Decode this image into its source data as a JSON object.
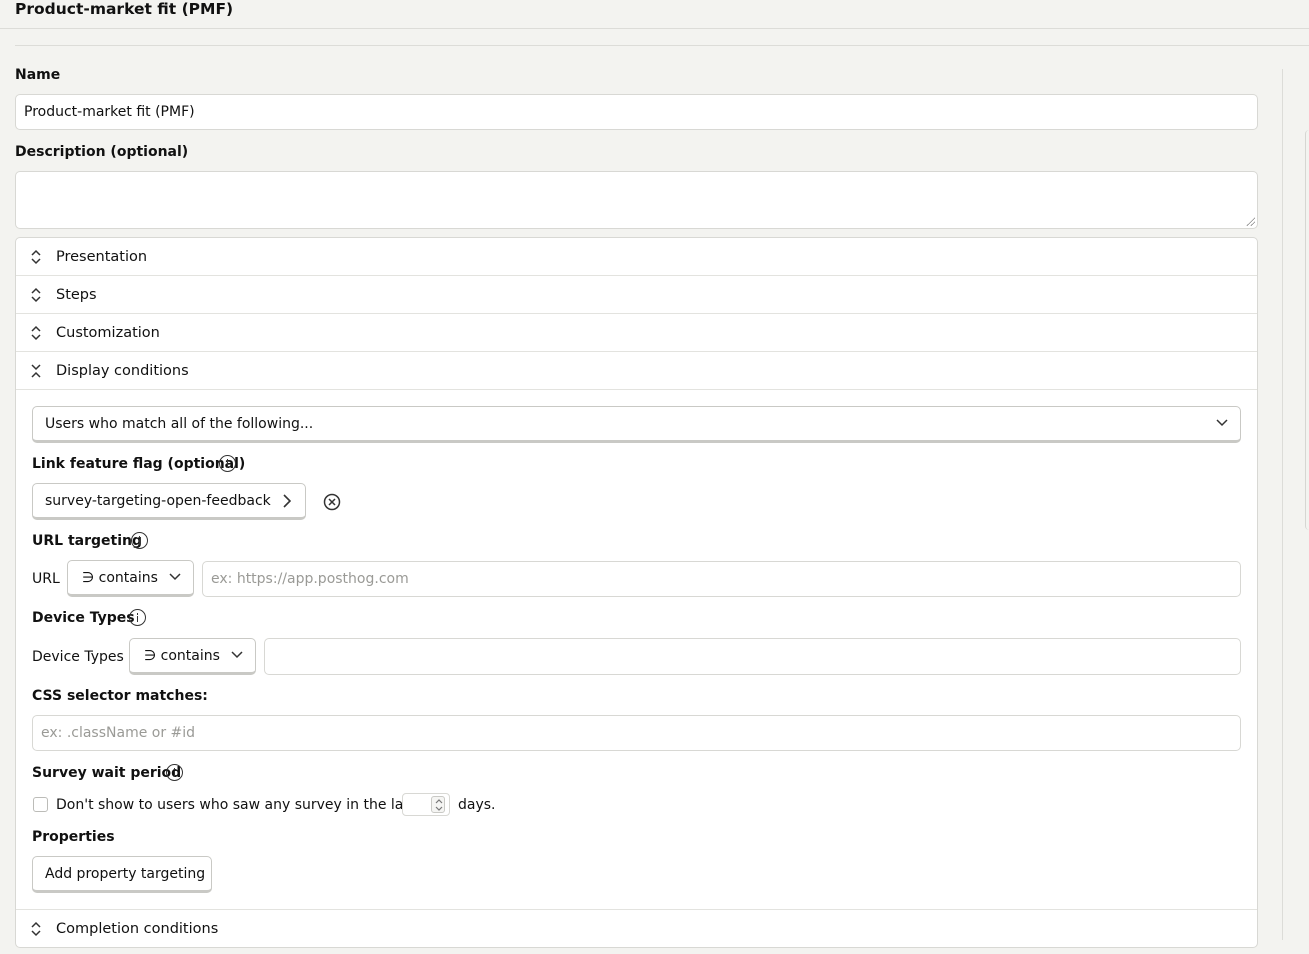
{
  "page": {
    "title": "Product-market fit (PMF)"
  },
  "name_field": {
    "label": "Name",
    "value": "Product-market fit (PMF)"
  },
  "description_field": {
    "label": "Description (optional)",
    "value": ""
  },
  "sections": [
    {
      "title": "Presentation",
      "expanded": false
    },
    {
      "title": "Steps",
      "expanded": false
    },
    {
      "title": "Customization",
      "expanded": false
    },
    {
      "title": "Display conditions",
      "expanded": true
    },
    {
      "title": "Completion conditions",
      "expanded": false
    }
  ],
  "display_conditions": {
    "match_select": "Users who match all of the following...",
    "feature_flag": {
      "label": "Link feature flag (optional)",
      "value": "survey-targeting-open-feedback"
    },
    "url_targeting": {
      "label": "URL targeting",
      "field_label": "URL",
      "operator": "∋ contains",
      "placeholder": "ex: https://app.posthog.com"
    },
    "device_types": {
      "label": "Device Types",
      "field_label": "Device Types",
      "operator": "∋ contains",
      "value": ""
    },
    "css_selector": {
      "label": "CSS selector matches:",
      "placeholder": "ex: .className or #id"
    },
    "wait_period": {
      "label": "Survey wait period",
      "checkbox_text": "Don't show to users who saw any survey in the last",
      "days_value": "",
      "suffix": "days.",
      "checked": false
    },
    "properties": {
      "label": "Properties",
      "button": "Add property targeting"
    }
  },
  "icons": {
    "collapsed": "chevron-up-down-icon",
    "expanded": "chevron-collapse-icon",
    "info": "info-icon",
    "remove": "close-circle-icon",
    "caret": "chevron-down-icon",
    "arrow": "chevron-right-icon"
  }
}
